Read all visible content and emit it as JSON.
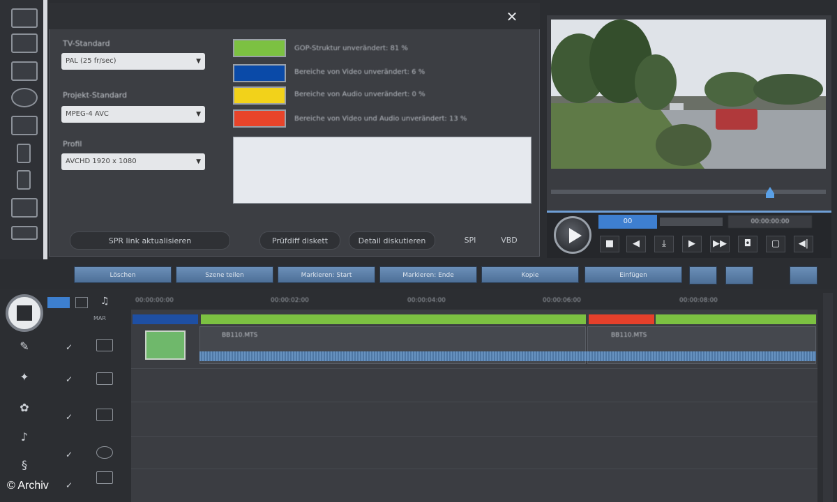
{
  "panel": {
    "close": "✕",
    "labels": {
      "tv_standard": "TV-Standard",
      "codec": "Projekt-Standard",
      "profile": "Profil"
    },
    "selects": {
      "tv_standard": "PAL (25 fr/sec)",
      "codec": "MPEG-4 AVC",
      "profile": "AVCHD 1920 x 1080"
    },
    "legend": [
      {
        "color": "#7cc142",
        "text": "GOP-Struktur unverändert: 81 %"
      },
      {
        "color": "#0a4aa8",
        "text": "Bereiche von Video unverändert: 6 %"
      },
      {
        "color": "#f2d21a",
        "text": "Bereiche von Audio unverändert: 0 %"
      },
      {
        "color": "#e8442a",
        "text": "Bereiche von Video und Audio unverändert: 13 %"
      }
    ],
    "buttons": {
      "update": "SPR link aktualisieren",
      "check": "Prüfdiff diskett",
      "detail": "Detail diskutieren",
      "opt1": "SPI",
      "opt2": "VBD"
    }
  },
  "player": {
    "timecode_left": "00",
    "timecode_right": "00:00:00:00"
  },
  "toolbar": {
    "buttons": [
      "Löschen",
      "Szene teilen",
      "Markieren: Start",
      "Markieren: Ende",
      "Kopie",
      "Einfügen"
    ]
  },
  "timeline": {
    "ruler": [
      "00:00:00:00",
      "00:00:02:00",
      "00:00:04:00",
      "00:00:06:00",
      "00:00:08:00"
    ],
    "clip1_label": "BB110.MTS",
    "clip2_label": "BB110.MTS",
    "track_label": "MAR"
  },
  "copyright": "© Archiv"
}
